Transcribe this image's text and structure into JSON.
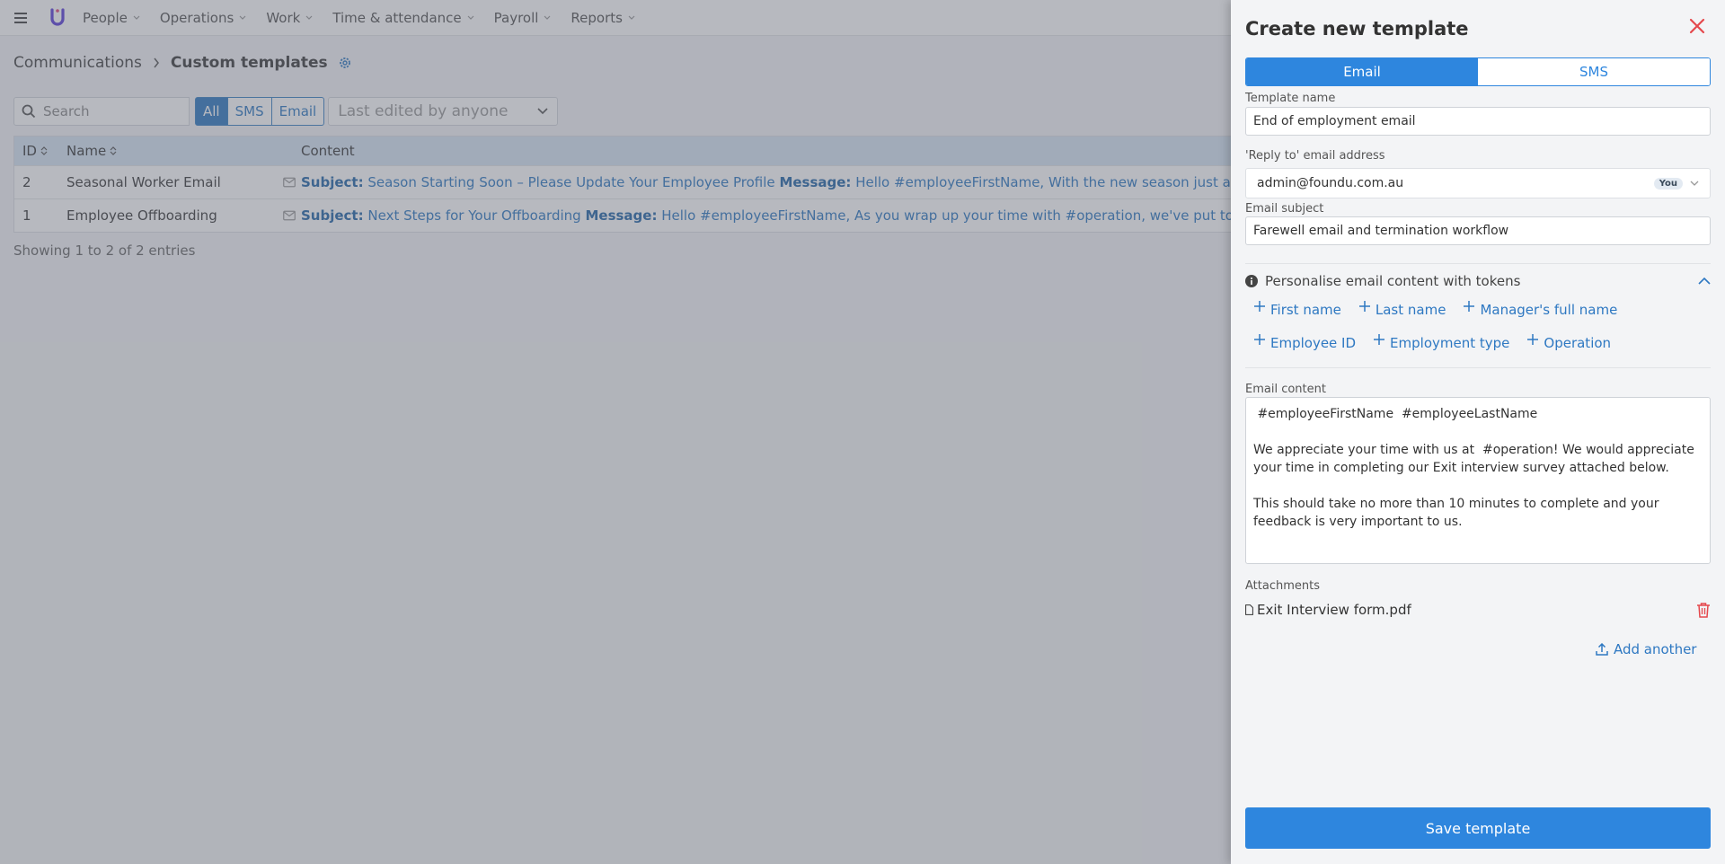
{
  "nav": {
    "items": [
      {
        "label": "People"
      },
      {
        "label": "Operations"
      },
      {
        "label": "Work"
      },
      {
        "label": "Time & attendance"
      },
      {
        "label": "Payroll"
      },
      {
        "label": "Reports"
      }
    ]
  },
  "breadcrumb": {
    "parent": "Communications",
    "current": "Custom templates"
  },
  "filters": {
    "search_placeholder": "Search",
    "type_options": [
      "All",
      "SMS",
      "Email"
    ],
    "selected_type": "All",
    "editor_placeholder": "Last edited by anyone"
  },
  "table": {
    "headers": {
      "id": "ID",
      "name": "Name",
      "content": "Content"
    },
    "rows": [
      {
        "id": "2",
        "name": "Seasonal Worker Email",
        "subject_label": "Subject:",
        "subject": "Season Starting Soon – Please Update Your Employee Profile",
        "message_label": "Message:",
        "message": "Hello #employeeFirstName, With the new season just around the corner"
      },
      {
        "id": "1",
        "name": "Employee Offboarding",
        "subject_label": "Subject:",
        "subject": "Next Steps for Your Offboarding",
        "message_label": "Message:",
        "message": "Hello #employeeFirstName, As you wrap up your time with #operation, we've put together"
      }
    ],
    "footer": "Showing 1 to 2 of 2 entries"
  },
  "drawer": {
    "title": "Create new template",
    "type_tabs": [
      {
        "label": "Email"
      },
      {
        "label": "SMS"
      }
    ],
    "active_type": "Email",
    "template_name": {
      "label": "Template name",
      "value": "End of employment email"
    },
    "reply_to": {
      "label": "'Reply to' email address",
      "value": "admin@foundu.com.au",
      "badge": "You"
    },
    "email_subject": {
      "label": "Email subject",
      "value": "Farewell email and termination workflow"
    },
    "tokens": {
      "header": "Personalise email content with tokens",
      "items": [
        "First name",
        "Last name",
        "Manager's full name",
        "Employee ID",
        "Employment type",
        "Operation"
      ]
    },
    "email_content": {
      "label": "Email content",
      "value": " #employeeFirstName  #employeeLastName\n\nWe appreciate your time with us at  #operation! We would appreciate your time in completing our Exit interview survey attached below.\n\nThis should take no more than 10 minutes to complete and your feedback is very important to us."
    },
    "attachments": {
      "label": "Attachments",
      "file": "Exit Interview form.pdf",
      "add_label": "Add another"
    },
    "save_label": "Save template"
  },
  "colors": {
    "primary": "#2e86de",
    "link": "#2e78c2",
    "close": "#e5484d",
    "delete": "#e5484d",
    "logo": "#5b3fd9"
  }
}
